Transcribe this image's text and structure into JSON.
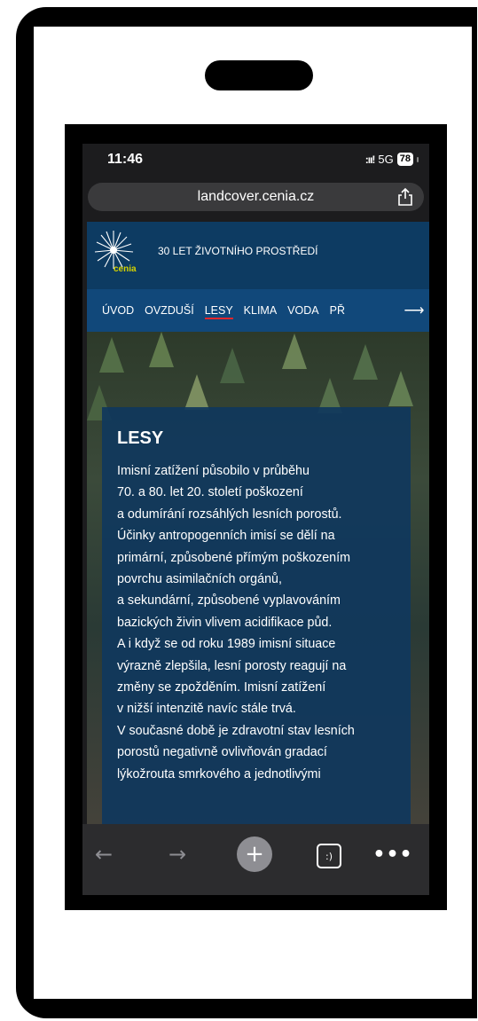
{
  "status_bar": {
    "time": "11:46",
    "signal": ":ıı!",
    "network": "5G",
    "battery": "78"
  },
  "browser": {
    "url": "landcover.cenia.cz"
  },
  "site": {
    "logo_text": "cenia",
    "tagline": "30 LET ŽIVOTNÍHO PROSTŘEDÍ",
    "nav": [
      "ÚVOD",
      "OVZDUŠÍ",
      "LESY",
      "KLIMA",
      "VODA",
      "PŘ"
    ],
    "active_nav": "LESY",
    "nav_arrow": "⟶"
  },
  "article": {
    "title": "LESY",
    "lines": [
      "Imisní zatížení působilo v průběhu",
      "70. a 80. let 20. století poškození",
      "a odumírání rozsáhlých lesních porostů.",
      "Účinky antropogenních imisí se dělí na",
      "primární, způsobené přímým poškozením",
      "povrchu asimilačních orgánů,",
      "a sekundární, způsobené vyplavováním",
      "bazických živin vlivem acidifikace půd.",
      "A i když se od roku 1989 imisní situace",
      "výrazně zlepšila, lesní porosty reagují na",
      "změny se zpožděním. Imisní zatížení",
      "v nižší intenzitě navíc stále trvá.",
      "V současné době je zdravotní stav lesních",
      "porostů negativně ovlivňován gradací",
      "lýkožrouta smrkového a jednotlivými"
    ]
  },
  "toolbar": {
    "back": "←",
    "forward": "→",
    "new_tab": "+",
    "tabs": ":)",
    "more": "•••"
  }
}
